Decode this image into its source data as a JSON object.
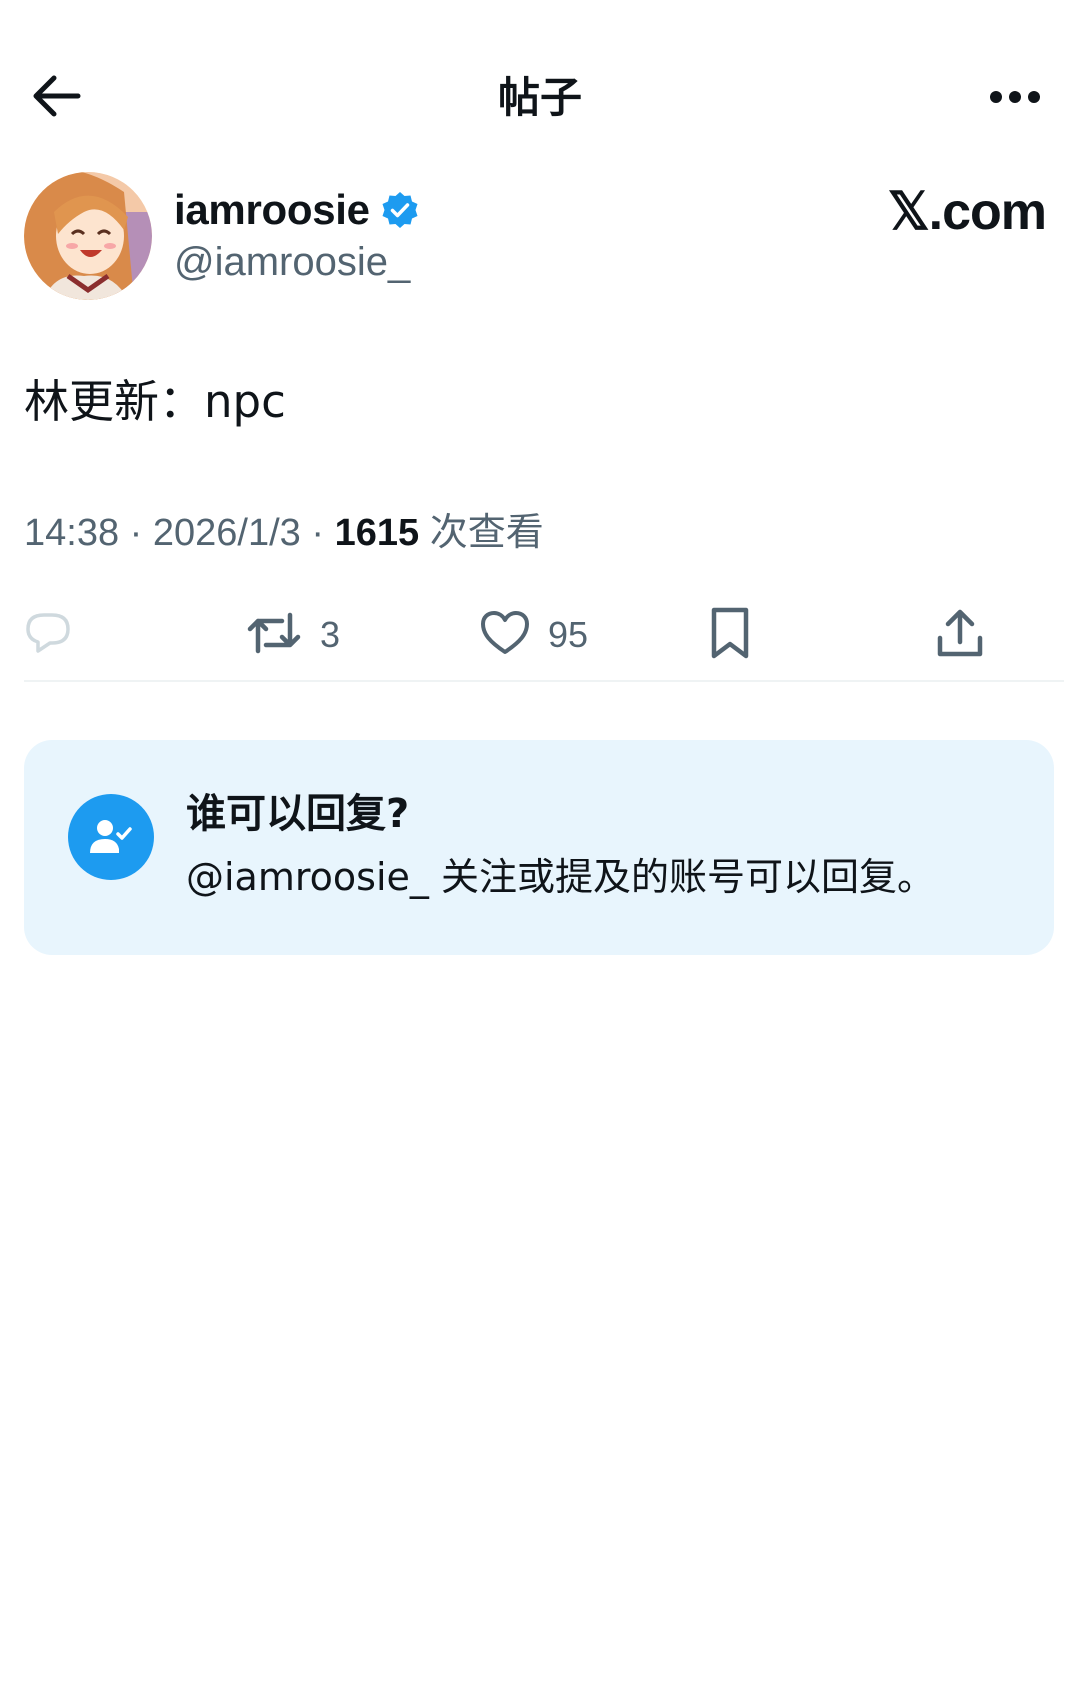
{
  "header": {
    "title": "帖子",
    "back_icon": "arrow-left-icon",
    "more_icon": "more-horizontal-icon"
  },
  "author": {
    "display_name": "iamroosie",
    "handle": "@iamroosie_",
    "verified": true,
    "verified_color": "#1d9bf0"
  },
  "brand": {
    "text": "𝕏.com"
  },
  "post": {
    "text": "林更新：npc",
    "time": "14:38",
    "separator_1": "·",
    "date": "2026/1/3",
    "separator_2": "·",
    "views_count": "1615",
    "views_label": "次查看"
  },
  "actions": {
    "reply_count": "",
    "repost_count": "3",
    "like_count": "95"
  },
  "reply_settings": {
    "title": "谁可以回复?",
    "description": "@iamroosie_ 关注或提及的账号可以回复。",
    "accent_color": "#1d9bf0",
    "background_color": "#e8f5fd"
  }
}
